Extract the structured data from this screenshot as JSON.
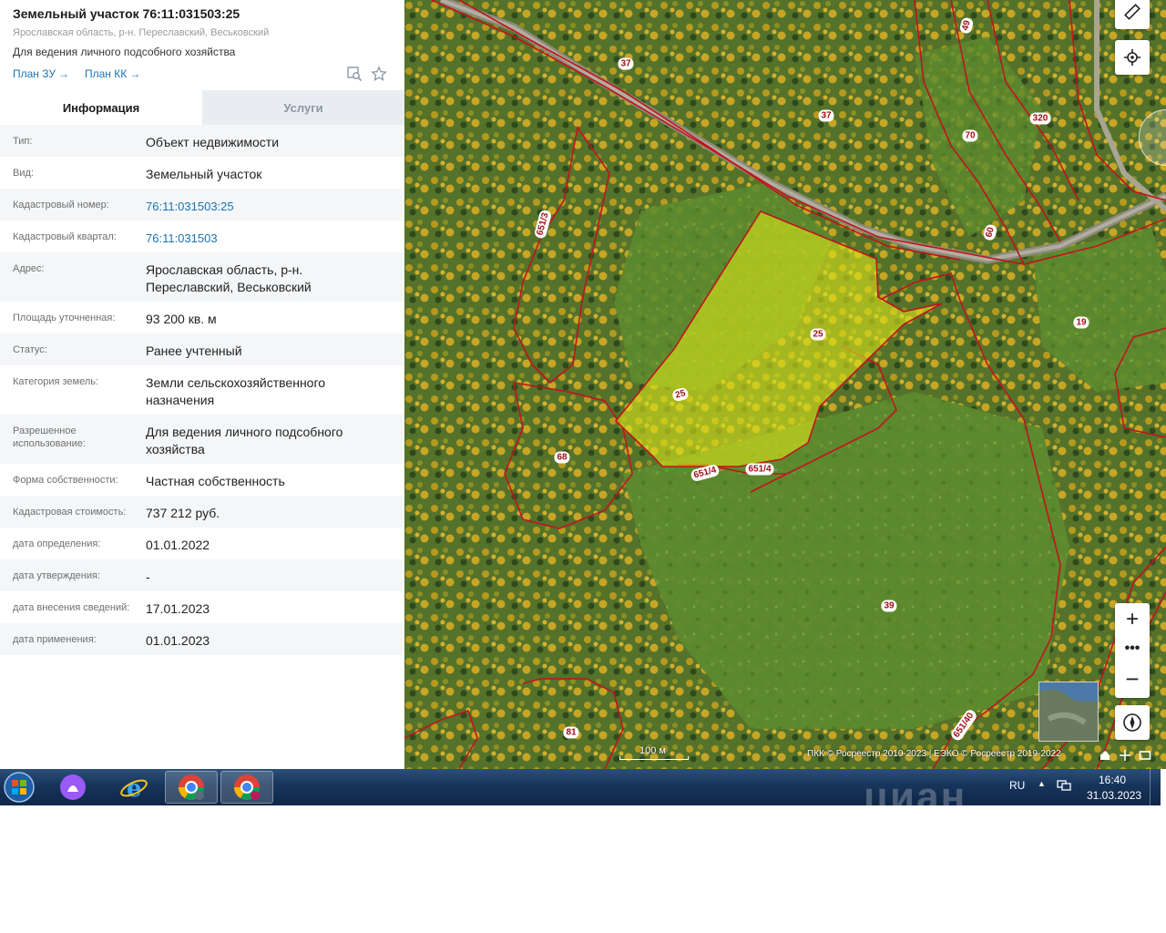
{
  "header": {
    "title": "Земельный участок 76:11:031503:25",
    "address": "Ярославская область, р-н. Переславский, Веськовский",
    "usage": "Для ведения личного подсобного хозяйства",
    "link_plan_zu": "План ЗУ",
    "link_plan_kk": "План КК"
  },
  "tabs": [
    {
      "label": "Информация",
      "active": true
    },
    {
      "label": "Услуги",
      "active": false
    }
  ],
  "rows": [
    {
      "key": "Тип:",
      "value": "Объект недвижимости"
    },
    {
      "key": "Вид:",
      "value": "Земельный участок"
    },
    {
      "key": "Кадастровый номер:",
      "value": "76:11:031503:25",
      "link": true
    },
    {
      "key": "Кадастровый квартал:",
      "value": "76:11:031503",
      "link": true
    },
    {
      "key": "Адрес:",
      "value": "Ярославская область, р-н. Переславский, Веськовский"
    },
    {
      "key": "Площадь уточненная:",
      "value": "93 200 кв. м"
    },
    {
      "key": "Статус:",
      "value": "Ранее учтенный"
    },
    {
      "key": "Категория земель:",
      "value": "Земли сельскохозяйственного назначения"
    },
    {
      "key": "Разрешенное использование:",
      "value": "Для ведения личного подсобного хозяйства"
    },
    {
      "key": "Форма собственности:",
      "value": "Частная собственность"
    },
    {
      "key": "Кадастровая стоимость:",
      "value": "737 212 руб."
    },
    {
      "key": "дата определения:",
      "value": "01.01.2022"
    },
    {
      "key": "дата утверждения:",
      "value": "-"
    },
    {
      "key": "дата внесения сведений:",
      "value": "17.01.2023"
    },
    {
      "key": "дата применения:",
      "value": "01.01.2023"
    }
  ],
  "map": {
    "labels": [
      "37",
      "37",
      "49",
      "70",
      "320",
      "651/3",
      "60",
      "25",
      "25",
      "19",
      "68",
      "651/4",
      "651/4",
      "39",
      "81",
      "651/40"
    ],
    "scale": "100 м",
    "copyright": "ПКК © Росреестр 2010-2023 | ЕЭКО © Росреестр 2019-2022",
    "icons": [
      "ruler-icon",
      "locate-icon",
      "zoom-in-icon",
      "more-icon",
      "zoom-out-icon",
      "compass-icon",
      "home-icon",
      "crosshair-icon",
      "fullscreen-icon"
    ],
    "colors": {
      "parcel_fill": "#d6e21a",
      "boundary": "#c0141c",
      "label_bg": "#ffffff"
    }
  },
  "taskbar": {
    "apps": [
      "start-orb",
      "alice-icon",
      "ie-icon",
      "chrome-icon",
      "chrome-icon"
    ],
    "lang": "RU",
    "time": "16:40",
    "date": "31.03.2023",
    "watermark": "циан"
  }
}
